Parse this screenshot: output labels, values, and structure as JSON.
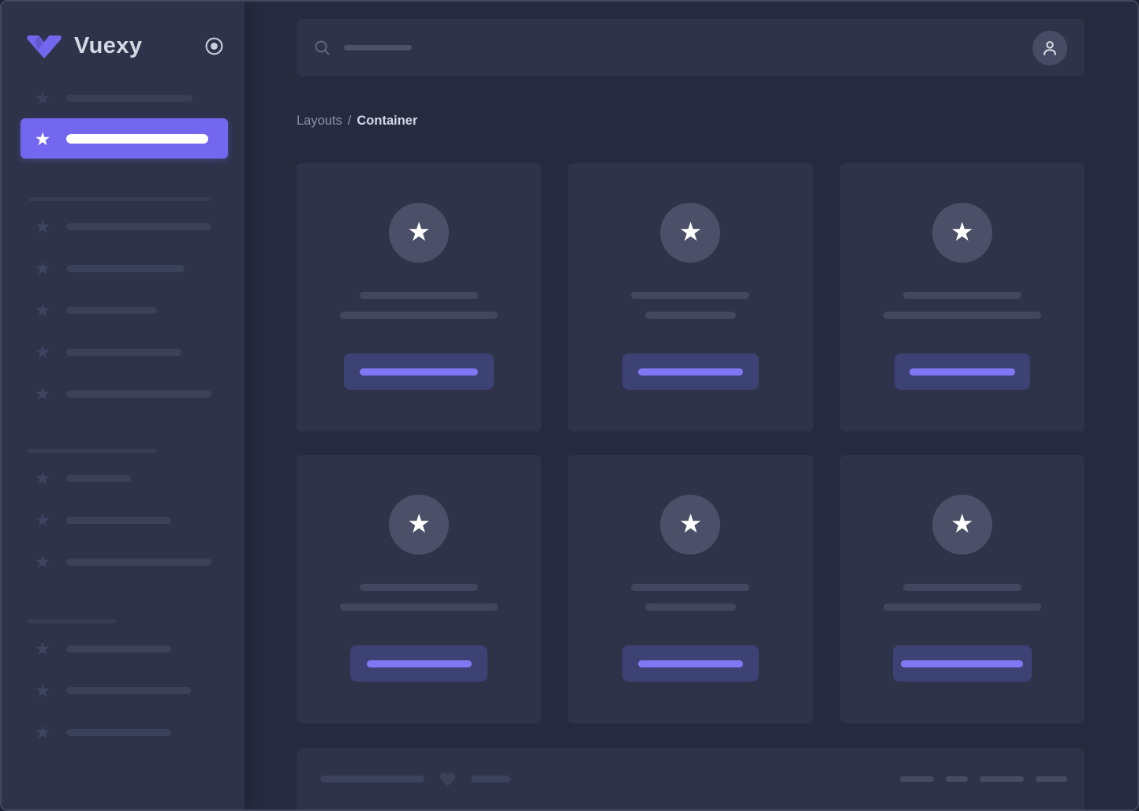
{
  "brand": {
    "name": "Vuexy"
  },
  "breadcrumb": {
    "parent": "Layouts",
    "separator": "/",
    "current": "Container"
  },
  "icons": {
    "logo": "vuexy-logo",
    "sidebar_toggle": "radio-dot-icon",
    "search": "search-icon",
    "user": "user-icon",
    "menu_bullet": "star-icon",
    "card_avatar": "star-icon",
    "favorite": "heart-icon"
  },
  "colors": {
    "primary": "#7367f0",
    "background": "#252a3e",
    "surface": "#2e3349",
    "skeleton_bar": "#3c415a",
    "card_text_bar": "#42475f",
    "button_skeleton_bg": "#3d4274",
    "button_skeleton_pill": "#8177f5",
    "active_item_text": "#ffffff"
  },
  "glyphs": {
    "star": "★"
  },
  "cards": {
    "count": 6,
    "skeleton": true,
    "rows": 2,
    "columns": 3
  }
}
